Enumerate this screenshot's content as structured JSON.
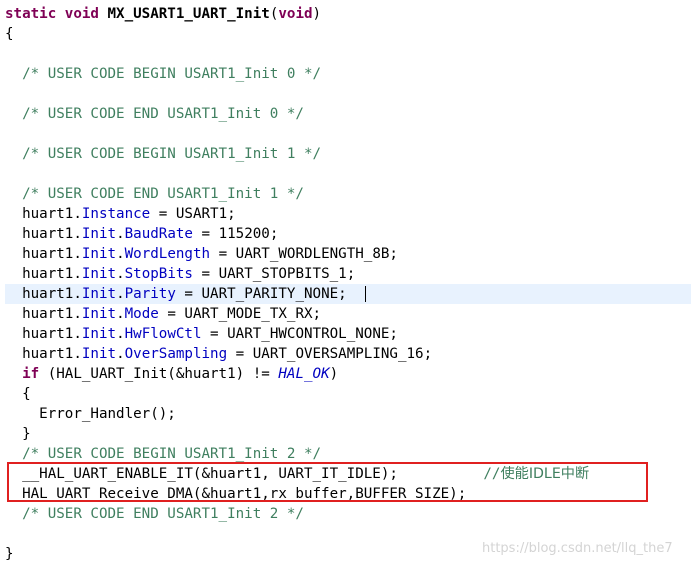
{
  "code": {
    "l01": {
      "kw1": "static",
      "kw2": "void",
      "name": "MX_USART1_UART_Init",
      "p1": "(",
      "kw3": "void",
      "p2": ")"
    },
    "l02": "{",
    "l04": "/* USER CODE BEGIN USART1_Init 0 */",
    "l06": "/* USER CODE END USART1_Init 0 */",
    "l08": "/* USER CODE BEGIN USART1_Init 1 */",
    "l10": "/* USER CODE END USART1_Init 1 */",
    "l11": {
      "obj": "huart1.",
      "field": "Instance",
      "rest": " = USART1;"
    },
    "l12": {
      "obj": "huart1.",
      "f1": "Init",
      "dot": ".",
      "f2": "BaudRate",
      "rest": " = 115200;"
    },
    "l13": {
      "obj": "huart1.",
      "f1": "Init",
      "dot": ".",
      "f2": "WordLength",
      "rest": " = UART_WORDLENGTH_8B;"
    },
    "l14": {
      "obj": "huart1.",
      "f1": "Init",
      "dot": ".",
      "f2": "StopBits",
      "rest": " = UART_STOPBITS_1;"
    },
    "l15": {
      "obj": "huart1.",
      "f1": "Init",
      "dot": ".",
      "f2": "Parity",
      "rest": " = UART_PARITY_NONE;"
    },
    "l16": {
      "obj": "huart1.",
      "f1": "Init",
      "dot": ".",
      "f2": "Mode",
      "rest": " = UART_MODE_TX_RX;"
    },
    "l17": {
      "obj": "huart1.",
      "f1": "Init",
      "dot": ".",
      "f2": "HwFlowCtl",
      "rest": " = UART_HWCONTROL_NONE;"
    },
    "l18": {
      "obj": "huart1.",
      "f1": "Init",
      "dot": ".",
      "f2": "OverSampling",
      "rest": " = UART_OVERSAMPLING_16;"
    },
    "l19": {
      "kw": "if",
      "mid": " (HAL_UART_Init(&huart1) != ",
      "macro": "HAL_OK",
      "end": ")"
    },
    "l20": "{",
    "l21": "Error_Handler();",
    "l22": "}",
    "l23": "/* USER CODE BEGIN USART1_Init 2 */",
    "l24": {
      "code": "__HAL_UART_ENABLE_IT(&huart1, UART_IT_IDLE);",
      "comment_prefix": "//",
      "comment_text": "使能IDLE中断"
    },
    "l25": "HAL_UART_Receive_DMA(&huart1,rx_buffer,BUFFER_SIZE);",
    "l26": "/* USER CODE END USART1_Init 2 */",
    "l28": "}"
  },
  "watermark": "https://blog.csdn.net/llq_the7",
  "colors": {
    "keyword": "#7f0055",
    "comment": "#3f7f5f",
    "field": "#0000c0",
    "current_line": "#e8f2fe",
    "highlight_box": "#e02020"
  }
}
